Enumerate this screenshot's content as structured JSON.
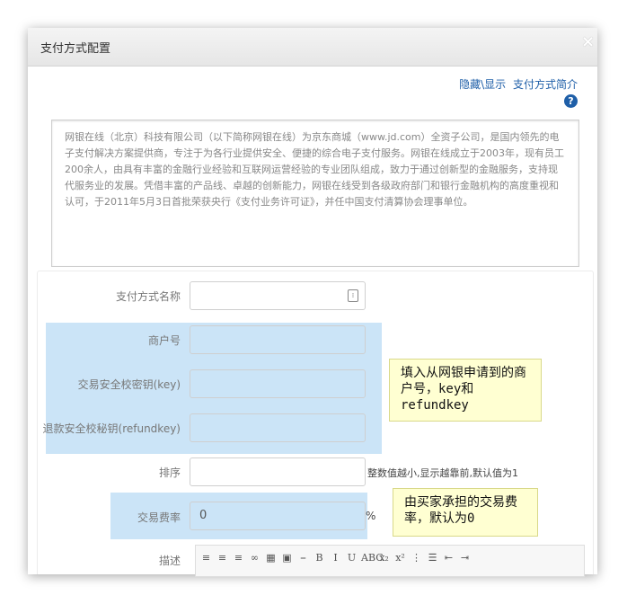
{
  "dialog": {
    "title": "支付方式配置",
    "close_glyph": "×",
    "toggle_link": "隐藏\\显示",
    "intro_link": "支付方式简介",
    "help_glyph": "?",
    "intro_text": "网银在线（北京）科技有限公司（以下简称网银在线）为京东商城（www.jd.com）全资子公司，是国内领先的电子支付解决方案提供商，专注于为各行业提供安全、便捷的综合电子支付服务。网银在线成立于2003年，现有员工200余人，由具有丰富的金融行业经验和互联网运营经验的专业团队组成，致力于通过创新型的金融服务，支持现代服务业的发展。凭借丰富的产品线、卓越的创新能力，网银在线受到各级政府部门和银行金融机构的高度重视和认可，于2011年5月3日首批荣获央行《支付业务许可证》，并任中国支付清算协会理事单位。"
  },
  "form": {
    "name_label": "支付方式名称",
    "merchant_label": "商户号",
    "key_label": "交易安全校密钥(key)",
    "refund_label": "退款安全校秘钥(refundkey)",
    "sort_label": "排序",
    "sort_hint": "整数值越小,显示越靠前,默认值为1",
    "fee_label": "交易费率",
    "fee_value": "0",
    "fee_unit": "%",
    "desc_label": "描述"
  },
  "notes": {
    "merchant_note": "填入从网银申请到的商户号，key和refundkey",
    "fee_note": "由买家承担的交易费率，默认为0"
  },
  "editor": {
    "buttons": [
      "≡",
      "≡",
      "≡",
      "∞",
      "▦",
      "▣",
      "⎯",
      "B",
      "I",
      "U",
      "ABC",
      "x₂",
      "x²",
      "⋮",
      "☰",
      "⇤",
      "⇥"
    ]
  },
  "colors": {
    "highlight": "#8cc4ee",
    "note_bg": "#ffffd2",
    "link": "#1f5fa8"
  }
}
